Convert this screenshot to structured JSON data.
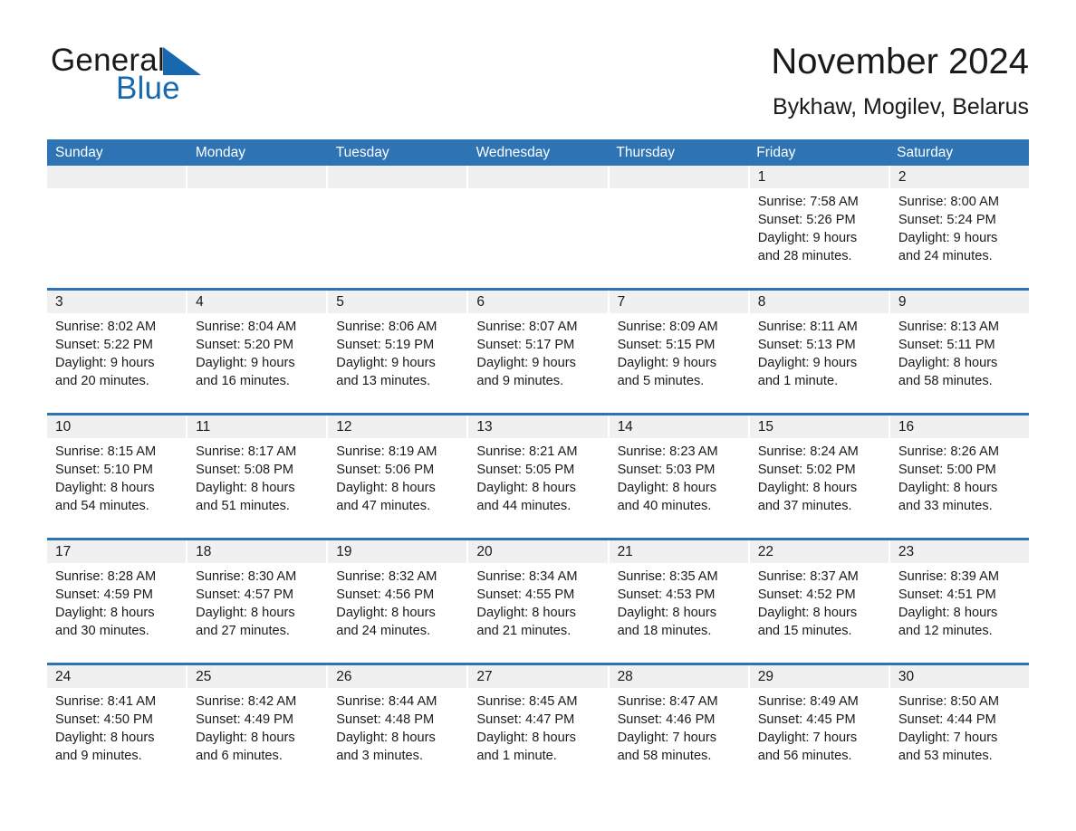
{
  "brand": {
    "word1": "General",
    "word2": "Blue",
    "triangle_color": "#1769AF",
    "text_color": "#1a1a1a"
  },
  "header": {
    "month_title": "November 2024",
    "location": "Bykhaw, Mogilev, Belarus"
  },
  "calendar": {
    "header_bg": "#2E74B5",
    "header_text_color": "#FFFFFF",
    "daynum_bg": "#F0F0F0",
    "weekdays": [
      "Sunday",
      "Monday",
      "Tuesday",
      "Wednesday",
      "Thursday",
      "Friday",
      "Saturday"
    ],
    "weeks": [
      [
        {
          "day": "",
          "empty": true,
          "lines": []
        },
        {
          "day": "",
          "empty": true,
          "lines": []
        },
        {
          "day": "",
          "empty": true,
          "lines": []
        },
        {
          "day": "",
          "empty": true,
          "lines": []
        },
        {
          "day": "",
          "empty": true,
          "lines": []
        },
        {
          "day": "1",
          "lines": [
            "Sunrise: 7:58 AM",
            "Sunset: 5:26 PM",
            "Daylight: 9 hours",
            "and 28 minutes."
          ]
        },
        {
          "day": "2",
          "lines": [
            "Sunrise: 8:00 AM",
            "Sunset: 5:24 PM",
            "Daylight: 9 hours",
            "and 24 minutes."
          ]
        }
      ],
      [
        {
          "day": "3",
          "lines": [
            "Sunrise: 8:02 AM",
            "Sunset: 5:22 PM",
            "Daylight: 9 hours",
            "and 20 minutes."
          ]
        },
        {
          "day": "4",
          "lines": [
            "Sunrise: 8:04 AM",
            "Sunset: 5:20 PM",
            "Daylight: 9 hours",
            "and 16 minutes."
          ]
        },
        {
          "day": "5",
          "lines": [
            "Sunrise: 8:06 AM",
            "Sunset: 5:19 PM",
            "Daylight: 9 hours",
            "and 13 minutes."
          ]
        },
        {
          "day": "6",
          "lines": [
            "Sunrise: 8:07 AM",
            "Sunset: 5:17 PM",
            "Daylight: 9 hours",
            "and 9 minutes."
          ]
        },
        {
          "day": "7",
          "lines": [
            "Sunrise: 8:09 AM",
            "Sunset: 5:15 PM",
            "Daylight: 9 hours",
            "and 5 minutes."
          ]
        },
        {
          "day": "8",
          "lines": [
            "Sunrise: 8:11 AM",
            "Sunset: 5:13 PM",
            "Daylight: 9 hours",
            "and 1 minute."
          ]
        },
        {
          "day": "9",
          "lines": [
            "Sunrise: 8:13 AM",
            "Sunset: 5:11 PM",
            "Daylight: 8 hours",
            "and 58 minutes."
          ]
        }
      ],
      [
        {
          "day": "10",
          "lines": [
            "Sunrise: 8:15 AM",
            "Sunset: 5:10 PM",
            "Daylight: 8 hours",
            "and 54 minutes."
          ]
        },
        {
          "day": "11",
          "lines": [
            "Sunrise: 8:17 AM",
            "Sunset: 5:08 PM",
            "Daylight: 8 hours",
            "and 51 minutes."
          ]
        },
        {
          "day": "12",
          "lines": [
            "Sunrise: 8:19 AM",
            "Sunset: 5:06 PM",
            "Daylight: 8 hours",
            "and 47 minutes."
          ]
        },
        {
          "day": "13",
          "lines": [
            "Sunrise: 8:21 AM",
            "Sunset: 5:05 PM",
            "Daylight: 8 hours",
            "and 44 minutes."
          ]
        },
        {
          "day": "14",
          "lines": [
            "Sunrise: 8:23 AM",
            "Sunset: 5:03 PM",
            "Daylight: 8 hours",
            "and 40 minutes."
          ]
        },
        {
          "day": "15",
          "lines": [
            "Sunrise: 8:24 AM",
            "Sunset: 5:02 PM",
            "Daylight: 8 hours",
            "and 37 minutes."
          ]
        },
        {
          "day": "16",
          "lines": [
            "Sunrise: 8:26 AM",
            "Sunset: 5:00 PM",
            "Daylight: 8 hours",
            "and 33 minutes."
          ]
        }
      ],
      [
        {
          "day": "17",
          "lines": [
            "Sunrise: 8:28 AM",
            "Sunset: 4:59 PM",
            "Daylight: 8 hours",
            "and 30 minutes."
          ]
        },
        {
          "day": "18",
          "lines": [
            "Sunrise: 8:30 AM",
            "Sunset: 4:57 PM",
            "Daylight: 8 hours",
            "and 27 minutes."
          ]
        },
        {
          "day": "19",
          "lines": [
            "Sunrise: 8:32 AM",
            "Sunset: 4:56 PM",
            "Daylight: 8 hours",
            "and 24 minutes."
          ]
        },
        {
          "day": "20",
          "lines": [
            "Sunrise: 8:34 AM",
            "Sunset: 4:55 PM",
            "Daylight: 8 hours",
            "and 21 minutes."
          ]
        },
        {
          "day": "21",
          "lines": [
            "Sunrise: 8:35 AM",
            "Sunset: 4:53 PM",
            "Daylight: 8 hours",
            "and 18 minutes."
          ]
        },
        {
          "day": "22",
          "lines": [
            "Sunrise: 8:37 AM",
            "Sunset: 4:52 PM",
            "Daylight: 8 hours",
            "and 15 minutes."
          ]
        },
        {
          "day": "23",
          "lines": [
            "Sunrise: 8:39 AM",
            "Sunset: 4:51 PM",
            "Daylight: 8 hours",
            "and 12 minutes."
          ]
        }
      ],
      [
        {
          "day": "24",
          "lines": [
            "Sunrise: 8:41 AM",
            "Sunset: 4:50 PM",
            "Daylight: 8 hours",
            "and 9 minutes."
          ]
        },
        {
          "day": "25",
          "lines": [
            "Sunrise: 8:42 AM",
            "Sunset: 4:49 PM",
            "Daylight: 8 hours",
            "and 6 minutes."
          ]
        },
        {
          "day": "26",
          "lines": [
            "Sunrise: 8:44 AM",
            "Sunset: 4:48 PM",
            "Daylight: 8 hours",
            "and 3 minutes."
          ]
        },
        {
          "day": "27",
          "lines": [
            "Sunrise: 8:45 AM",
            "Sunset: 4:47 PM",
            "Daylight: 8 hours",
            "and 1 minute."
          ]
        },
        {
          "day": "28",
          "lines": [
            "Sunrise: 8:47 AM",
            "Sunset: 4:46 PM",
            "Daylight: 7 hours",
            "and 58 minutes."
          ]
        },
        {
          "day": "29",
          "lines": [
            "Sunrise: 8:49 AM",
            "Sunset: 4:45 PM",
            "Daylight: 7 hours",
            "and 56 minutes."
          ]
        },
        {
          "day": "30",
          "lines": [
            "Sunrise: 8:50 AM",
            "Sunset: 4:44 PM",
            "Daylight: 7 hours",
            "and 53 minutes."
          ]
        }
      ]
    ]
  }
}
